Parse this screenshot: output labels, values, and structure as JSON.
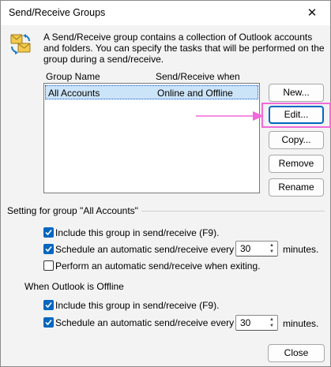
{
  "window": {
    "title": "Send/Receive Groups",
    "close_glyph": "✕"
  },
  "description": "A Send/Receive group contains a collection of Outlook accounts and folders. You can specify the tasks that will be performed on the group during a send/receive.",
  "list": {
    "columns": [
      "Group Name",
      "Send/Receive when"
    ],
    "rows": [
      {
        "name": "All Accounts",
        "when": "Online and Offline",
        "selected": true
      }
    ]
  },
  "buttons": {
    "new": "New...",
    "edit": "Edit...",
    "copy": "Copy...",
    "remove": "Remove",
    "rename": "Rename",
    "close": "Close"
  },
  "group_settings": {
    "label": "Setting for group \"All Accounts\"",
    "include": {
      "label": "Include this group in send/receive (F9).",
      "checked": true
    },
    "schedule": {
      "label": "Schedule an automatic send/receive every",
      "checked": true,
      "value": "30",
      "unit": "minutes."
    },
    "on_exit": {
      "label": "Perform an automatic send/receive when exiting.",
      "checked": false
    }
  },
  "offline_settings": {
    "label": "When Outlook is Offline",
    "include": {
      "label": "Include this group in send/receive (F9).",
      "checked": true
    },
    "schedule": {
      "label": "Schedule an automatic send/receive every",
      "checked": true,
      "value": "30",
      "unit": "minutes."
    }
  },
  "colors": {
    "accent": "#0067c0",
    "selection": "#cce4f7",
    "annotation": "#ef6bd8"
  }
}
